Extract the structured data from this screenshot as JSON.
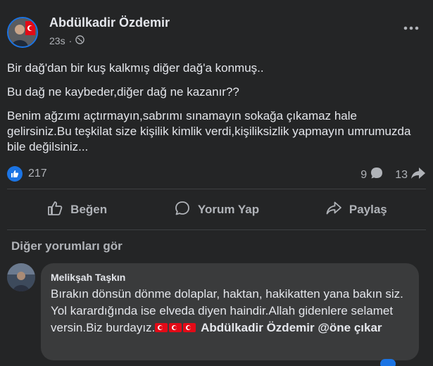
{
  "post": {
    "author": "Abdülkadir Özdemir",
    "time": "23s",
    "audience_icon": "globe-icon",
    "paragraphs": [
      "Bir dağ'dan bir kuş kalkmış diğer dağ'a konmuş..",
      "Bu dağ ne kaybeder,diğer dağ ne kazanır??",
      "Benim ağzımı açtırmayın,sabrımı sınamayın sokağa çıkamaz hale gelirsiniz.Bu teşkilat size kişilik kimlik verdi,kişiliksizlik yapmayın umrumuzda bile değilsiniz..."
    ],
    "likes": "217",
    "comments": "9",
    "shares": "13"
  },
  "actions": {
    "like": "Beğen",
    "comment": "Yorum Yap",
    "share": "Paylaş"
  },
  "more_comments": "Diğer yorumları gör",
  "comment": {
    "author": "Melikşah Taşkın",
    "text": "Bırakın dönsün dönme dolaplar, haktan, hakikatten yana bakın siz. Yol karardığında ise elveda diyen haindir.Allah gidenlere selamet versin.Biz burdayız.",
    "mention": "Abdülkadir Özdemir @öne çıkar"
  },
  "colors": {
    "background": "#242526",
    "bubble": "#3a3b3c",
    "accent": "#1b74e4",
    "text": "#e4e6eb",
    "muted": "#b0b3b8"
  }
}
